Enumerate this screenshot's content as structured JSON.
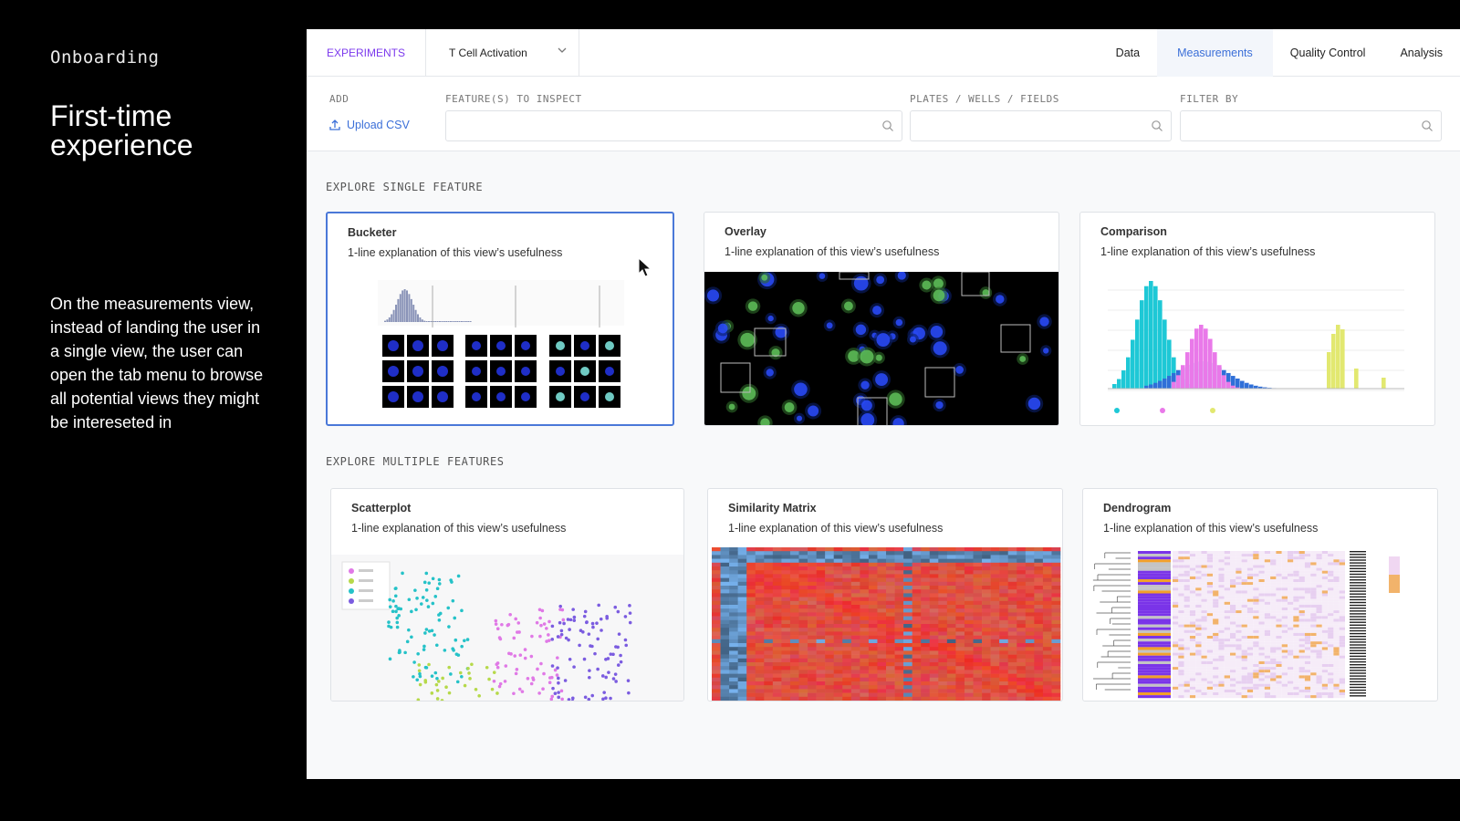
{
  "sidebar": {
    "kicker": "Onboarding",
    "title_line1": "First-time",
    "title_line2": "experience",
    "description": "On the measurements view, instead of landing the user in a single view, the user can open the tab menu to browse all potential views they might be intereseted in"
  },
  "topbar": {
    "experiments_label": "EXPERIMENTS",
    "experiment_selected": "T Cell Activation",
    "tabs": [
      "Data",
      "Measurements",
      "Quality Control",
      "Analysis"
    ],
    "active_tab": "Measurements"
  },
  "filters": {
    "add_label": "ADD",
    "upload_label": "Upload CSV",
    "features_label": "FEATURE(S) TO INSPECT",
    "plates_label": "PLATES / WELLS / FIELDS",
    "filter_label": "FILTER BY"
  },
  "sections": {
    "single": "EXPLORE SINGLE FEATURE",
    "multiple": "EXPLORE MULTIPLE FEATURES"
  },
  "single_cards": [
    {
      "title": "Bucketer",
      "desc": "1-line explanation of this view’s usefulness"
    },
    {
      "title": "Overlay",
      "desc": "1-line explanation of this view’s usefulness"
    },
    {
      "title": "Comparison",
      "desc": "1-line explanation of this view’s usefulness"
    }
  ],
  "multiple_cards": [
    {
      "title": "Scatterplot",
      "desc": "1-line explanation of this view’s usefulness"
    },
    {
      "title": "Similarity Matrix",
      "desc": "1-line explanation of this view’s usefulness"
    },
    {
      "title": "Dendrogram",
      "desc": "1-line explanation of this view’s usefulness"
    }
  ],
  "icons": {
    "upload": "upload-icon",
    "search": "search-icon",
    "chevron": "chevron-down-icon",
    "cursor": "mouse-pointer-icon"
  },
  "colors": {
    "accent_purple": "#7c3aed",
    "accent_blue": "#3b6fd8",
    "selected_border": "#4a78d8"
  }
}
